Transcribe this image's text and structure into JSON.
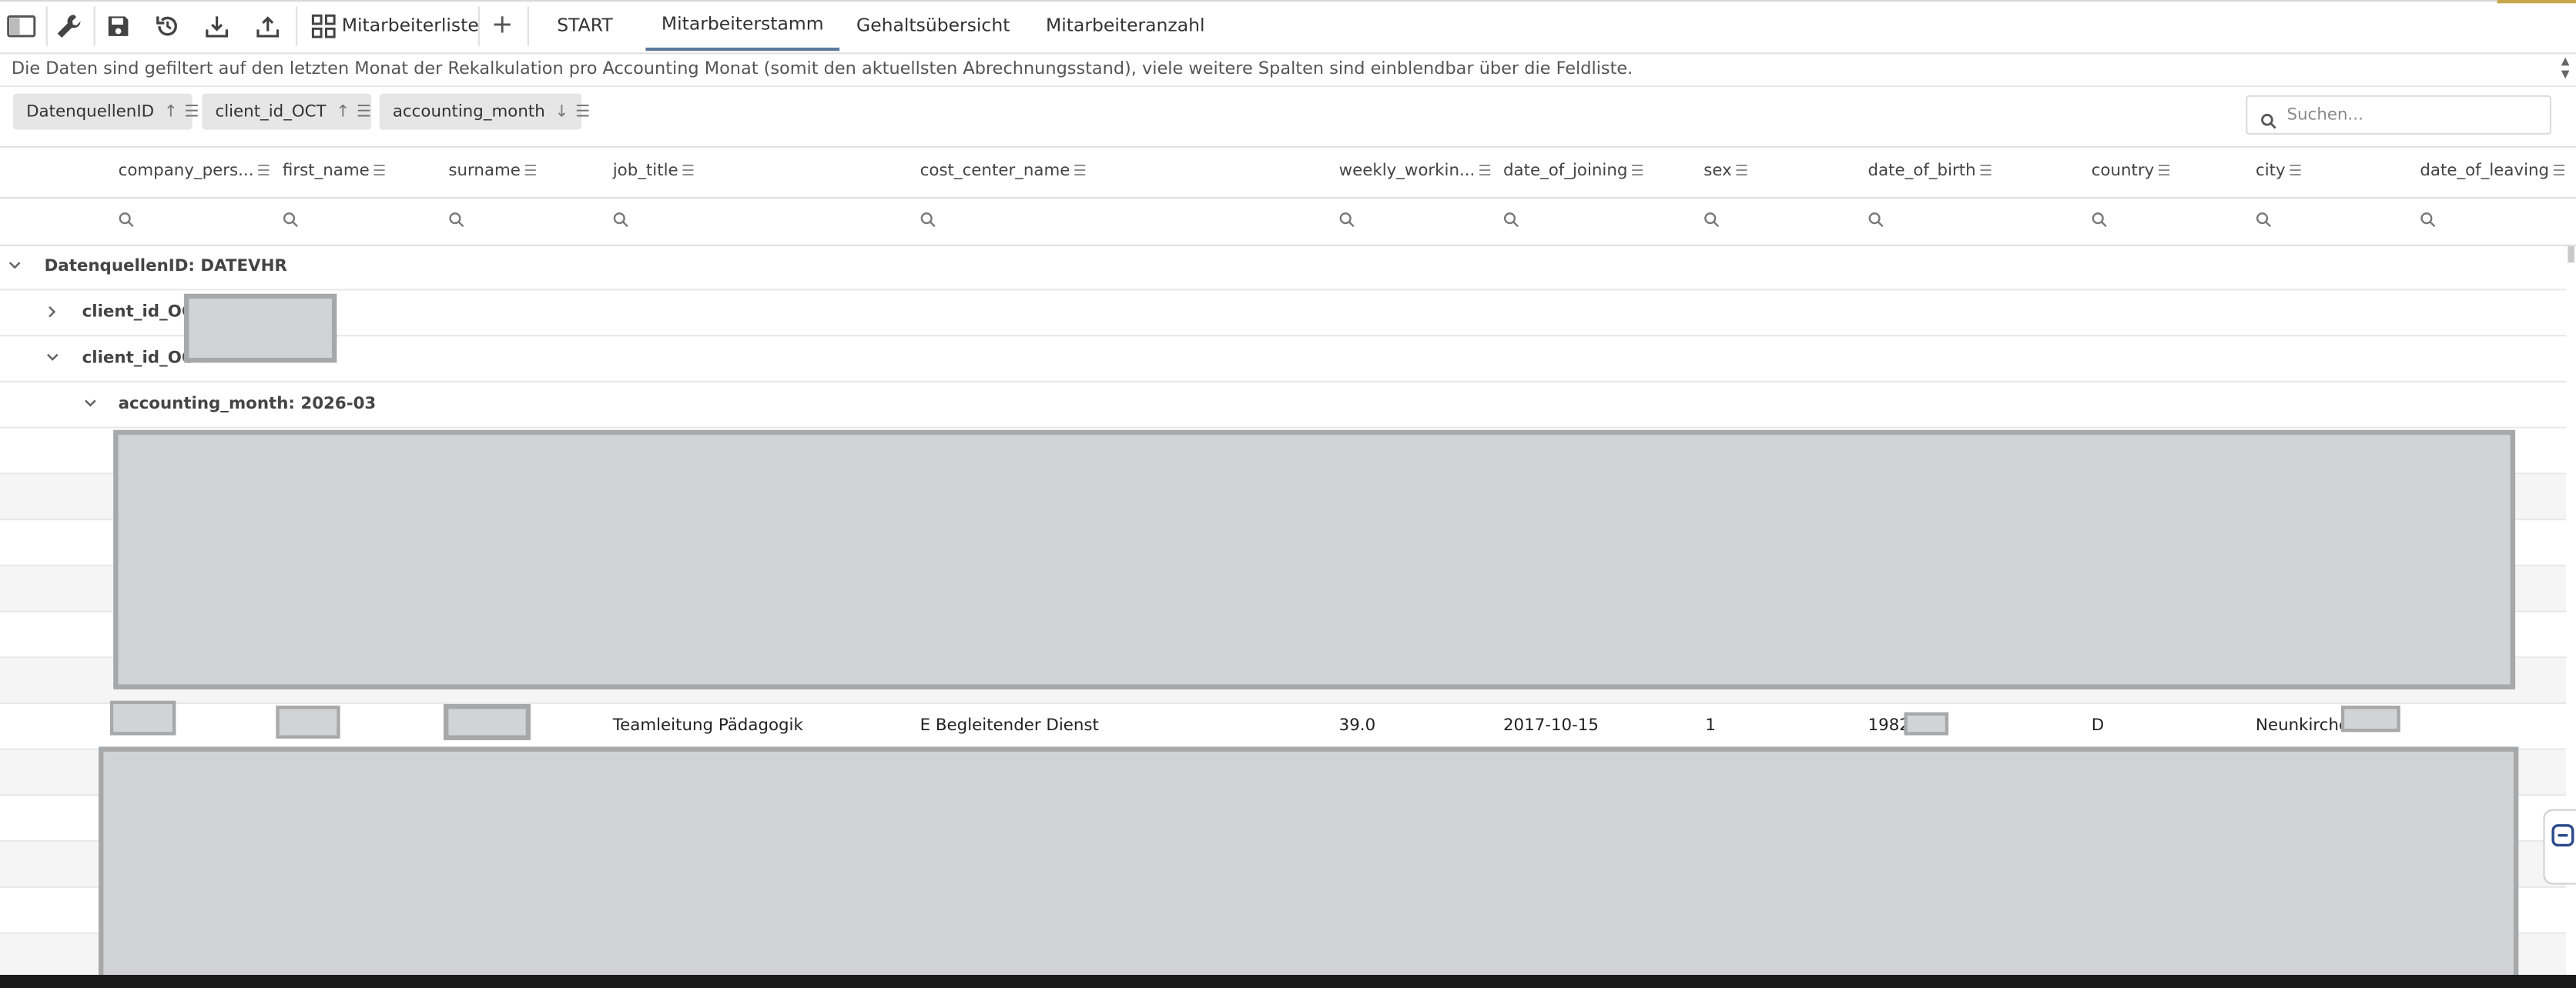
{
  "toolbar": {
    "icons": [
      "panel-icon",
      "wrench-icon",
      "save-icon",
      "refresh-icon",
      "download-icon",
      "upload-icon",
      "grid-icon"
    ],
    "employee_list_label": "Mitarbeiterliste",
    "add_symbol": "+",
    "tabs": [
      "START",
      "Mitarbeiterstamm",
      "Gehaltsübersicht",
      "Mitarbeiteranzahl"
    ],
    "active_tab": "Mitarbeiterstamm"
  },
  "info": {
    "text": "Die Daten sind gefiltert auf den letzten Monat der Rekalkulation pro Accounting Monat (somit den aktuellsten Abrechnungsstand), viele weitere Spalten sind einblendbar über die Feldliste."
  },
  "group_panel": {
    "chips": [
      {
        "label": "DatenquellenID",
        "sort": "↑"
      },
      {
        "label": "client_id_OCT",
        "sort": "↑"
      },
      {
        "label": "accounting_month",
        "sort": "↓"
      }
    ],
    "search_placeholder": "Suchen..."
  },
  "columns": [
    "company_pers...",
    "first_name",
    "surname",
    "job_title",
    "cost_center_name",
    "weekly_workin...",
    "date_of_joining",
    "sex",
    "date_of_birth",
    "country",
    "city",
    "date_of_leaving"
  ],
  "groups": {
    "datasource": "DatenquellenID: DATEVHR",
    "client_1": "client_id_OCT:",
    "client_2": "client_id_OCT:",
    "month": "accounting_month: 2026-03"
  },
  "visible_row": {
    "job_title": "Teamleitung Pädagogik",
    "cost_center_name": "E Begleitender Dienst",
    "weekly_working_hours": "39.0",
    "date_of_joining": "2017-10-15",
    "sex": "1",
    "date_of_birth": "1982",
    "country": "D",
    "city": "Neunkirchen"
  },
  "colors": {
    "active_tab_underline": "#5c7a9a",
    "redaction_fill": "#d2d3d5",
    "redaction_border": "#a7a8aa",
    "alt_row": "#f5f5f5"
  }
}
